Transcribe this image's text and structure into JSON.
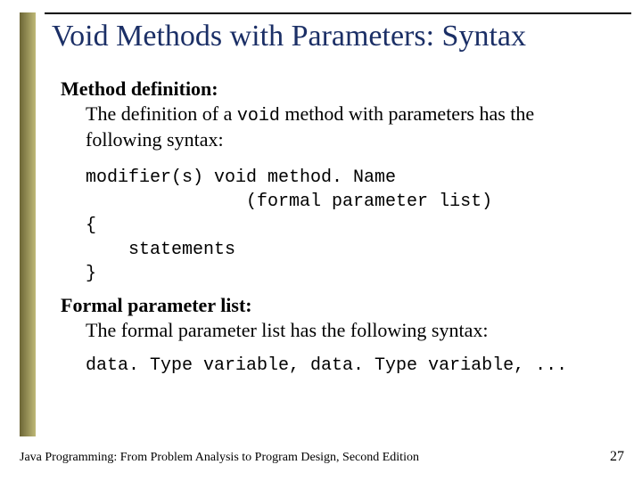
{
  "title": "Void Methods with Parameters: Syntax",
  "section1": {
    "label": "Method definition:",
    "desc_pre": "The definition of a ",
    "desc_code": "void",
    "desc_post": " method with parameters has the following syntax:"
  },
  "code": {
    "l1": "modifier(s) void method. Name",
    "l2": "               (formal parameter list)",
    "l3": "{",
    "l4": "    statements",
    "l5": "}"
  },
  "section2": {
    "label": "Formal parameter list:",
    "desc": "The formal parameter list has the following syntax:"
  },
  "codeline2": "data. Type variable, data. Type variable, ...",
  "footer": {
    "left": "Java Programming: From Problem Analysis to Program Design, Second Edition",
    "page": "27"
  }
}
